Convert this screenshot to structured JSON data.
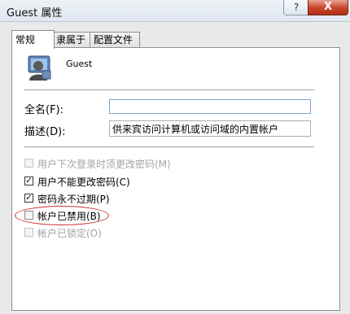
{
  "window": {
    "title": "Guest 属性",
    "help_label": "?",
    "close_label": "X"
  },
  "tabs": [
    {
      "label": "常规",
      "active": true
    },
    {
      "label": "隶属于",
      "active": false
    },
    {
      "label": "配置文件",
      "active": false
    }
  ],
  "user": {
    "name": "Guest",
    "avatar_icon": "user-avatar-icon"
  },
  "fields": {
    "full_name_label": "全名(F):",
    "full_name_value": "",
    "description_label": "描述(D):",
    "description_value": "供来宾访问计算机或访问域的内置帐户"
  },
  "options": [
    {
      "label": "用户下次登录时须更改密码(M)",
      "checked": false,
      "enabled": false
    },
    {
      "label": "用户不能更改密码(C)",
      "checked": true,
      "enabled": true
    },
    {
      "label": "密码永不过期(P)",
      "checked": true,
      "enabled": true
    },
    {
      "label": "帐户已禁用(B)",
      "checked": false,
      "enabled": true,
      "highlighted": true
    },
    {
      "label": "帐户已锁定(O)",
      "checked": false,
      "enabled": false
    }
  ]
}
